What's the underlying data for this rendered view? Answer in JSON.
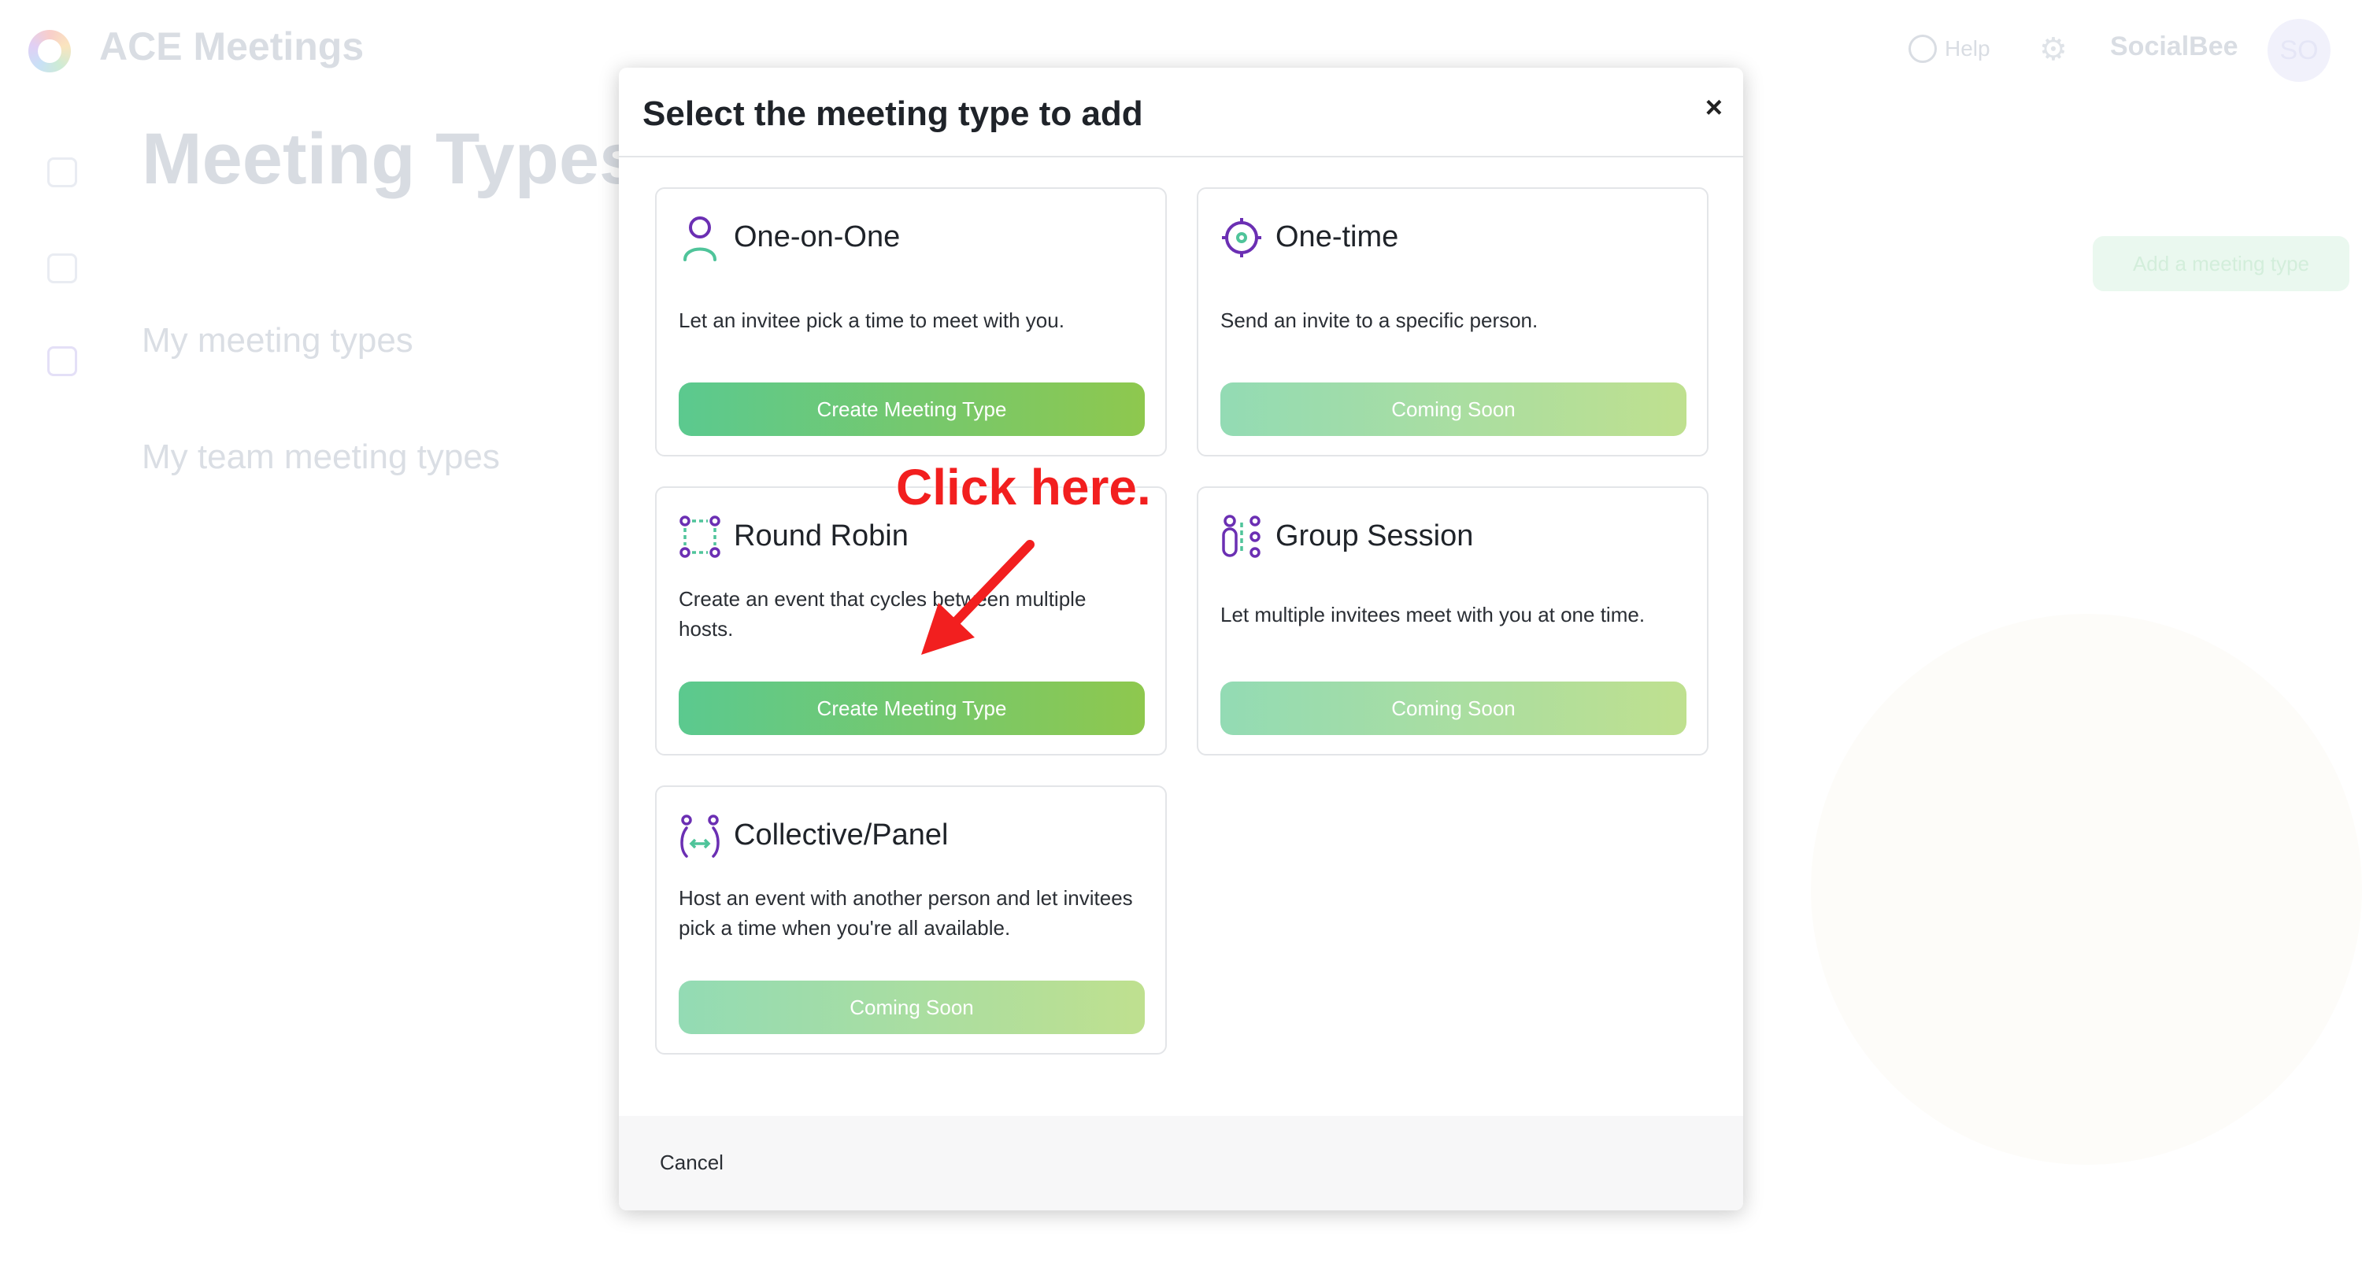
{
  "app": {
    "title": "ACE Meetings",
    "help_label": "Help",
    "company_name": "SocialBee",
    "avatar_initials": "SO"
  },
  "page": {
    "heading": "Meeting Types",
    "my_types": "My meeting types",
    "team_types": "My team meeting types",
    "add_button": "Add a meeting type"
  },
  "modal": {
    "title": "Select the meeting type to add",
    "close_symbol": "×",
    "cancel_label": "Cancel",
    "cards": [
      {
        "title": "One-on-One",
        "description": "Let an invitee pick a time to meet with you.",
        "button": "Create Meeting Type",
        "button_state": "enabled",
        "icon": "person-icon"
      },
      {
        "title": "One-time",
        "description": "Send an invite to a specific person.",
        "button": "Coming Soon",
        "button_state": "disabled",
        "icon": "target-icon"
      },
      {
        "title": "Round Robin",
        "description": "Create an event that cycles between multiple hosts.",
        "button": "Create Meeting Type",
        "button_state": "enabled",
        "icon": "round-robin-icon"
      },
      {
        "title": "Group Session",
        "description": "Let multiple invitees meet with you at one time.",
        "button": "Coming Soon",
        "button_state": "disabled",
        "icon": "group-icon"
      },
      {
        "title": "Collective/Panel",
        "description": "Host an event with another person and let invitees pick a time when you're all available.",
        "button": "Coming Soon",
        "button_state": "disabled",
        "icon": "collective-icon"
      }
    ]
  },
  "annotation": {
    "text": "Click here.",
    "color": "#f21f1f"
  },
  "colors": {
    "button_gradient_start": "#5bc98f",
    "button_gradient_end": "#8ec84e",
    "icon_purple": "#6b2fb3",
    "icon_green": "#4fc49a"
  }
}
